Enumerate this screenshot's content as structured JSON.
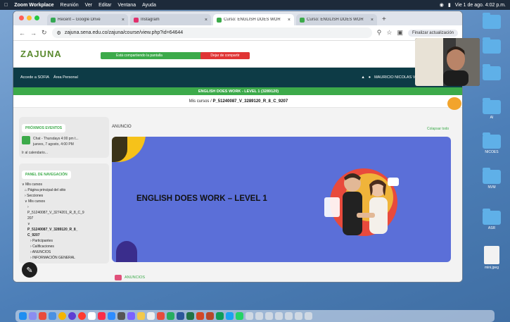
{
  "menubar": {
    "app": "Zoom Workplace",
    "items": [
      "Reunión",
      "Ver",
      "Editar",
      "Ventana",
      "Ayuda"
    ],
    "clock": "Vie 1 de ago. 4:02 p.m."
  },
  "tabs": [
    {
      "label": "Recent – Google Drive",
      "color": "#34a853",
      "active": false
    },
    {
      "label": "Instagram",
      "color": "#e1306c",
      "active": false
    },
    {
      "label": "Curso: ENGLISH DOES WOR",
      "color": "#3caa4a",
      "active": true
    },
    {
      "label": "Curso: ENGLISH DOES WOR",
      "color": "#3caa4a",
      "active": false
    }
  ],
  "toolbar": {
    "url": "zajuna.sena.edu.co/zajuna/course/view.php?id=64644",
    "update": "Finalizar actualización"
  },
  "moodle": {
    "logo": "ZAJUNA",
    "share_text": "Está compartiendo la pantalla",
    "stop_text": "Dejar de compartir",
    "nav_links": [
      "Accede a SOFIA",
      "Área Personal"
    ],
    "user": "MAURICIO NICOLAS VELEZ SIERRA",
    "course_title": "ENGLISH DOES WORK - LEVEL 1 (3289120)",
    "breadcrumb_prefix": "Mis cursos",
    "breadcrumb_course": "P_51240087_V_3289120_R_8_C_9207"
  },
  "sidebar": {
    "events_title": "PRÓXIMOS EVENTOS",
    "event_text": "Chat - Thursdays 4:00 pm t...",
    "event_date": "jueves, 7 agosto, 4:00 PM",
    "calendar_link": "Ir al calendario...",
    "nav_title": "PANEL DE NAVEGACIÓN",
    "nav_items": [
      "Mis cursos",
      "Página principal del sitio",
      "Secciones",
      "Mis cursos",
      "P_51240087_V_3274201_R_8_C_9",
      "207",
      "P_51240087_V_3289120_R_8_",
      "C_9207",
      "Participantes",
      "Calificaciones",
      "ANUNCIOS",
      "INFORMACIÓN GENERAL"
    ]
  },
  "main": {
    "section": "ANUNCIO",
    "collapse": "Colapsar todo",
    "banner_title": "ENGLISH DOES WORK – LEVEL 1",
    "bottom_section": "ANUNCIOS"
  },
  "desktop_icons": [
    "AI",
    "NICOES",
    "NVM",
    "ASR",
    "mini.jpeg"
  ]
}
